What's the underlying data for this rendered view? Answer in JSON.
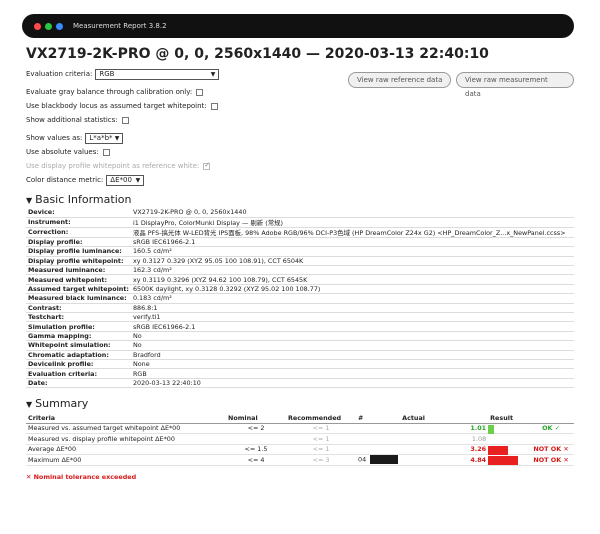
{
  "window": {
    "title": "Measurement Report 3.8.2"
  },
  "heading": "VX2719-2K-PRO @ 0, 0, 2560x1440 — 2020-03-13 22:40:10",
  "controls": {
    "evaluation_criteria_label": "Evaluation criteria:",
    "evaluation_criteria_value": "RGB",
    "gray_balance_label": "Evaluate gray balance through calibration only:",
    "blackbody_label": "Use blackbody locus as assumed target whitepoint:",
    "additional_stats_label": "Show additional statistics:",
    "show_values_label": "Show values as:",
    "show_values_value": "L*a*b*",
    "absolute_values_label": "Use absolute values:",
    "display_profile_white_label": "Use display profile whitepoint as reference white:",
    "color_distance_label": "Color distance metric:",
    "color_distance_value": "ΔE*00",
    "view_reference_btn": "View raw reference data",
    "view_measurement_btn": "View raw measurement data"
  },
  "basic_info": {
    "title": "Basic Information",
    "rows": [
      {
        "key": "Device:",
        "value": "VX2719-2K-PRO @ 0, 0, 2560x1440"
      },
      {
        "key": "Instrument:",
        "value": "i1 DisplayPro, ColorMunki Display — 剔新 (常规)"
      },
      {
        "key": "Correction:",
        "value": "液晶 PFS-搞光体 W-LED背光 IPS面板, 98% Adobe RGB/96% DCI-P3色域 (HP DreamColor Z24x G2) <HP_DreamColor_Z...x_NewPanel.ccss>"
      },
      {
        "key": "Display profile:",
        "value": "sRGB IEC61966-2.1"
      },
      {
        "key": "Display profile luminance:",
        "value": "160.5 cd/m²"
      },
      {
        "key": "Display profile whitepoint:",
        "value": "xy 0.3127 0.329 (XYZ 95.05 100 108.91), CCT 6504K"
      },
      {
        "key": "Measured luminance:",
        "value": "162.3 cd/m²"
      },
      {
        "key": "Measured whitepoint:",
        "value": "xy 0.3119 0.3296 (XYZ 94.62 100 108.79), CCT 6545K"
      },
      {
        "key": "Assumed target whitepoint:",
        "value": "6500K daylight, xy 0.3128 0.3292 (XYZ 95.02 100 108.77)"
      },
      {
        "key": "Measured black luminance:",
        "value": "0.183 cd/m²"
      },
      {
        "key": "Contrast:",
        "value": "886.8:1"
      },
      {
        "key": "Testchart:",
        "value": "verify.ti1"
      },
      {
        "key": "Simulation profile:",
        "value": "sRGB IEC61966-2.1"
      },
      {
        "key": "Gamma mapping:",
        "value": "No"
      },
      {
        "key": "Whitepoint simulation:",
        "value": "No"
      },
      {
        "key": "Chromatic adaptation:",
        "value": "Bradford"
      },
      {
        "key": "Devicelink profile:",
        "value": "None"
      },
      {
        "key": "Evaluation criteria:",
        "value": "RGB"
      },
      {
        "key": "Date:",
        "value": "2020-03-13 22:40:10"
      }
    ]
  },
  "summary": {
    "title": "Summary",
    "headers": {
      "criteria": "Criteria",
      "nominal": "Nominal",
      "recommended": "Recommended",
      "num": "#",
      "actual": "Actual",
      "result": "Result"
    },
    "rows": [
      {
        "criteria": "Measured vs. assumed target whitepoint ΔE*00",
        "nominal": "<= 2",
        "recommended": "<= 1",
        "num": "",
        "actual": "1.01",
        "bar_fraction": 0.07,
        "bar_color": "#6ad04a",
        "actual_class": "act-ok",
        "result": "OK ✓",
        "result_class": "res-ok"
      },
      {
        "criteria": "Measured vs. display profile whitepoint ΔE*00",
        "nominal": "",
        "recommended": "<= 1",
        "num": "",
        "actual": "1.08",
        "bar_fraction": 0.0,
        "bar_color": "#ffffff",
        "actual_class": "act-dim",
        "result": "",
        "result_class": ""
      },
      {
        "criteria": "Average ΔE*00",
        "nominal": "<= 1.5",
        "recommended": "<= 1",
        "num": "",
        "actual": "3.26",
        "bar_fraction": 0.25,
        "bar_color": "#e82020",
        "actual_class": "act-bad",
        "result": "NOT OK ✕",
        "result_class": "res-bad"
      },
      {
        "criteria": "Maximum ΔE*00",
        "nominal": "<= 4",
        "recommended": "<= 3",
        "num": "04",
        "actual": "4.84",
        "bar_fraction": 0.37,
        "bar_color": "#e82020",
        "actual_class": "act-bad",
        "result": "NOT OK ✕",
        "result_class": "res-bad"
      }
    ],
    "footnote": "✕ Nominal tolerance exceeded"
  }
}
